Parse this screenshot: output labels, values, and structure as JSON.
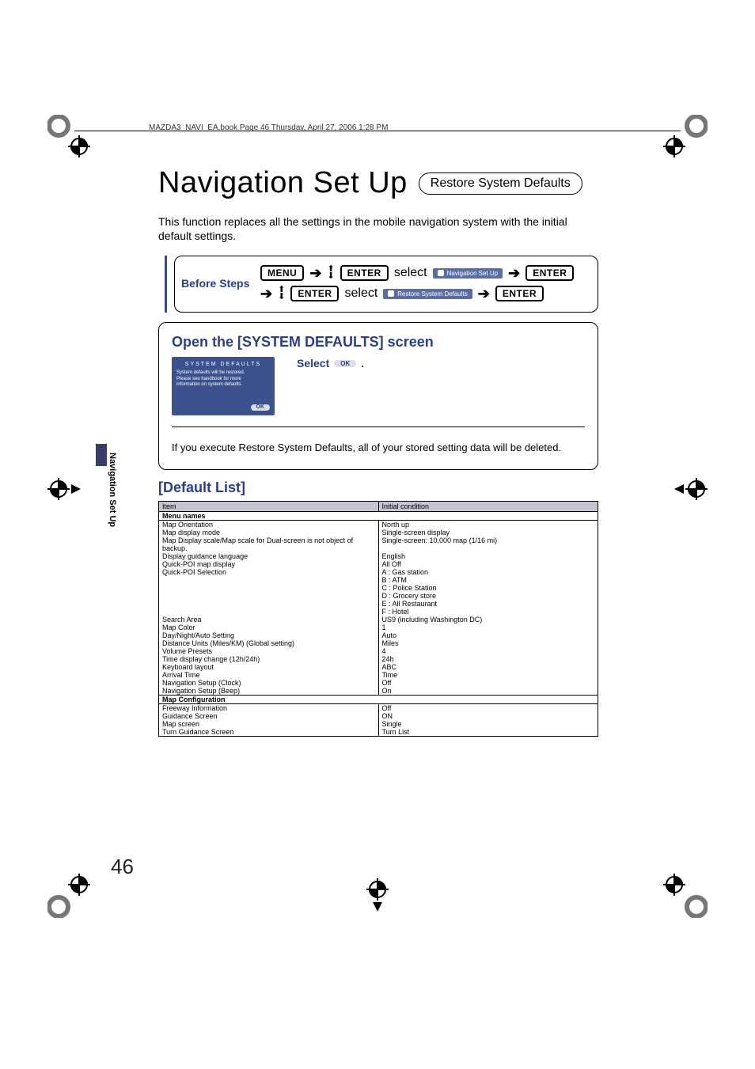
{
  "header_line": "MAZDA3_NAVI_EA.book  Page 46  Thursday, April 27, 2006  1:28 PM",
  "side_tab": "Navigation Set Up",
  "page_number": "46",
  "title": "Navigation Set Up",
  "pill": "Restore System Defaults",
  "intro": "This function replaces all the settings in the mobile navigation system with the initial default settings.",
  "before_label": "Before Steps",
  "keys": {
    "menu": "MENU",
    "enter": "ENTER",
    "select": "select"
  },
  "chips": {
    "nav_setup": "Navigation Set Up",
    "restore": "Restore System Defaults"
  },
  "open_heading": "Open the [SYSTEM DEFAULTS] screen",
  "select_label": "Select",
  "period": ".",
  "ok_label": "OK",
  "mock": {
    "title": "SYSTEM DEFAULTS",
    "l1": "System defaults will be restored.",
    "l2": "Please see handbook for more",
    "l3": "information on system defaults."
  },
  "warn": "If you execute Restore System Defaults, all of your stored setting data will be deleted.",
  "default_list_heading": "[Default List]",
  "table": {
    "head_item": "Item",
    "head_cond": "Initial condition",
    "section_menu": "Menu names",
    "section_map": "Map Configuration",
    "rows_menu": [
      {
        "item": "Map Orientation",
        "val": "North up"
      },
      {
        "item": "Map display mode",
        "val": "Single-screen display"
      },
      {
        "item": "Map Display scale/Map scale for Dual-screen is not object of backup.",
        "val": "Single-screen: 10,000 map (1/16 mi)"
      },
      {
        "item": "Display guidance language",
        "val": "English"
      },
      {
        "item": "Quick-POI map display",
        "val": "All Off"
      },
      {
        "item": "Quick-POI Selection",
        "val": "A : Gas station"
      },
      {
        "item": "",
        "val": "B : ATM"
      },
      {
        "item": "",
        "val": "C : Police Station"
      },
      {
        "item": "",
        "val": "D : Grocery store"
      },
      {
        "item": "",
        "val": "E : All Restaurant"
      },
      {
        "item": "",
        "val": "F : Hotel"
      },
      {
        "item": "Search Area",
        "val": "US9 (including Washington DC)"
      },
      {
        "item": "Map Color",
        "val": "1"
      },
      {
        "item": "Day/Night/Auto Setting",
        "val": "Auto"
      },
      {
        "item": "Distance Units (Miles/KM) (Global setting)",
        "val": "Miles"
      },
      {
        "item": "Volume Presets",
        "val": "4"
      },
      {
        "item": "Time display change (12h/24h)",
        "val": "24h"
      },
      {
        "item": "Keyboard layout",
        "val": "ABC"
      },
      {
        "item": "Arrival Time",
        "val": "Time"
      },
      {
        "item": "Navigation Setup (Clock)",
        "val": "Off"
      },
      {
        "item": "Navigation Setup (Beep)",
        "val": "On"
      }
    ],
    "rows_map": [
      {
        "item": "Freeway Information",
        "val": "Off"
      },
      {
        "item": "Guidance Screen",
        "val": "ON"
      },
      {
        "item": "Map screen",
        "val": "Single"
      },
      {
        "item": "Turn Guidance Screen",
        "val": "Turn List"
      }
    ]
  }
}
